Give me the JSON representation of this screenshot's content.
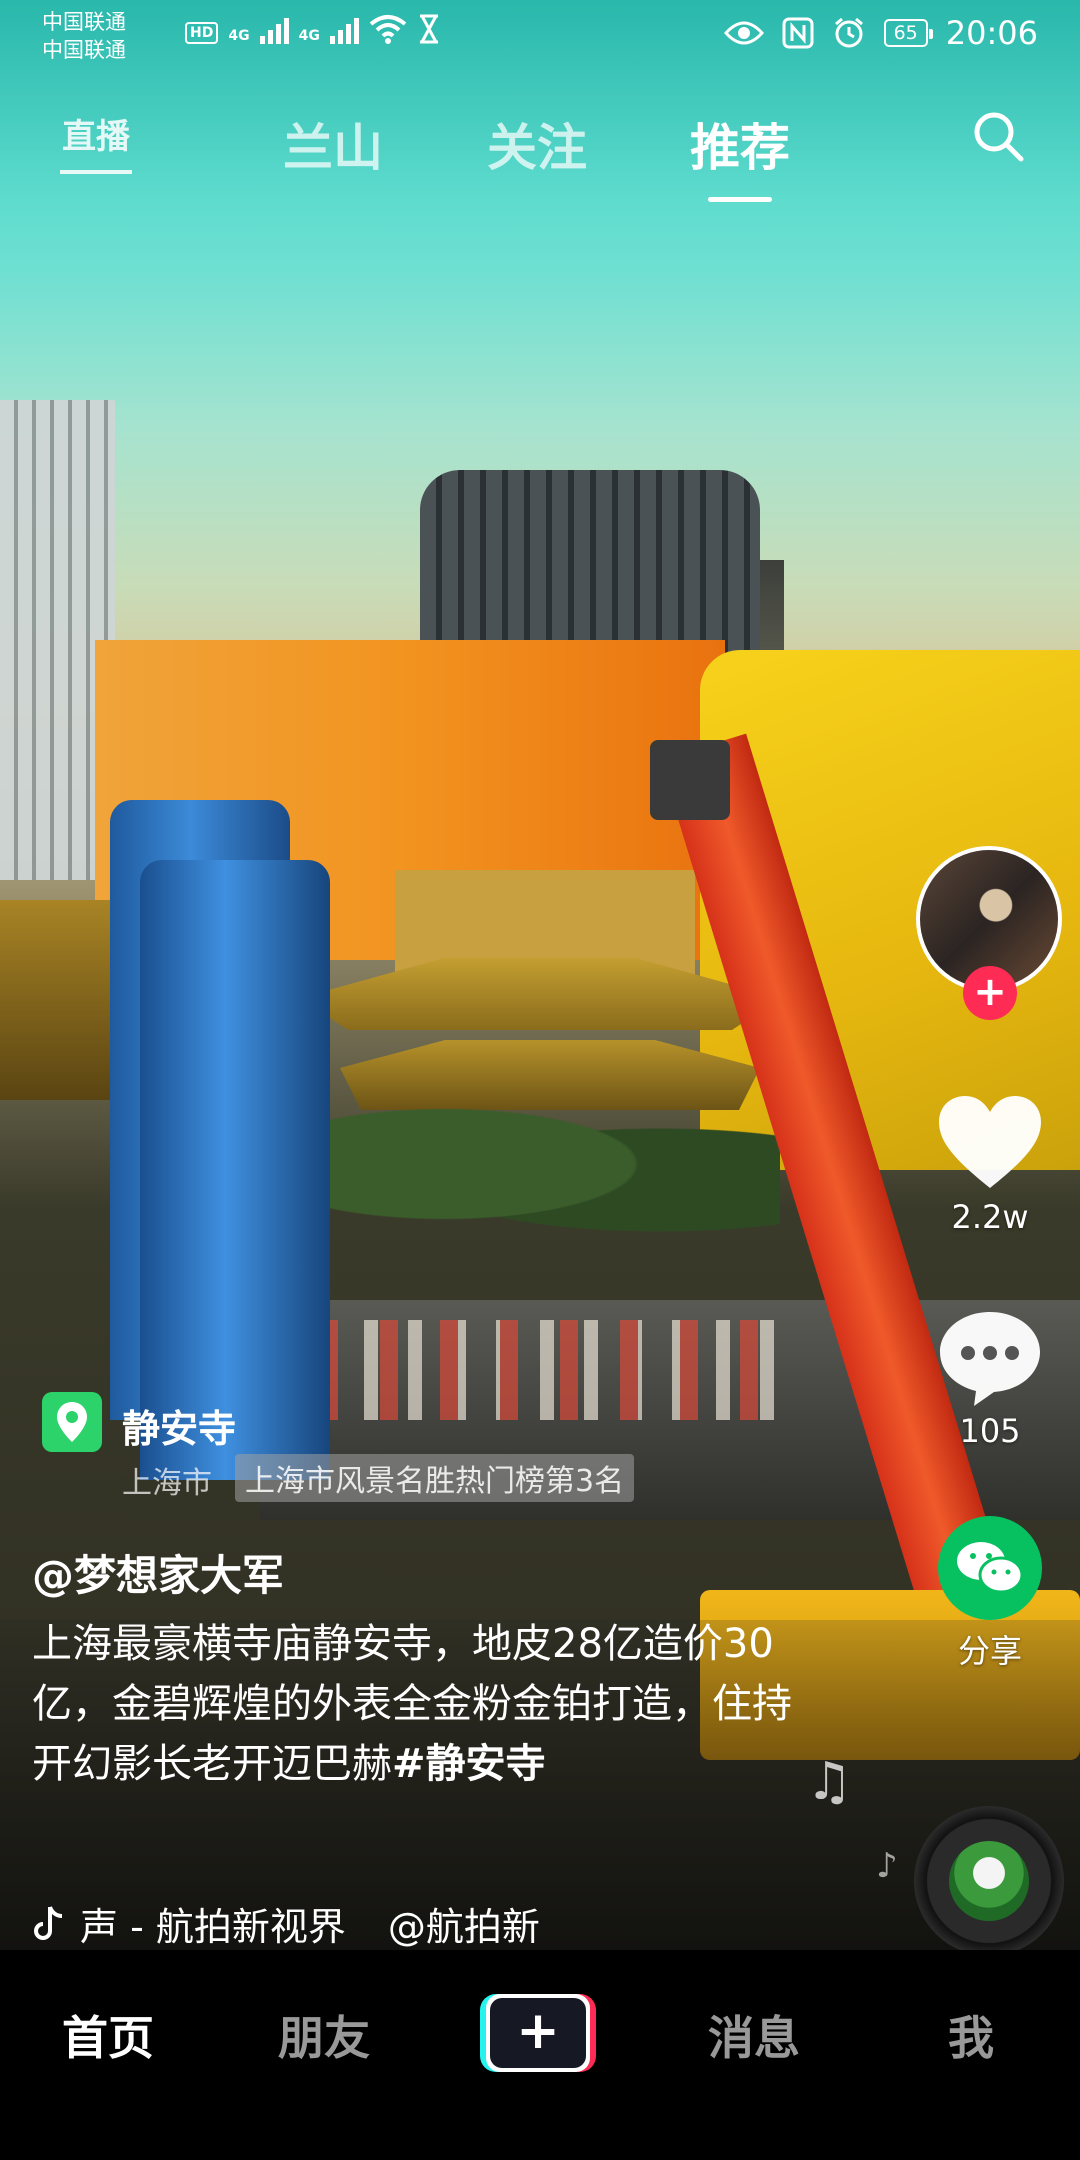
{
  "status_bar": {
    "carrier_1": "中国联通",
    "carrier_2": "中国联通",
    "hd_badge": "HD",
    "network_1": "4G",
    "network_2": "4G",
    "battery": "65",
    "time": "20:06"
  },
  "top_nav": {
    "live_label": "直播",
    "tabs": [
      "兰山",
      "关注",
      "推荐"
    ],
    "active_tab": "推荐"
  },
  "actions": {
    "like_count": "2.2w",
    "comment_count": "105",
    "share_label": "分享"
  },
  "poi": {
    "name": "静安寺",
    "city": "上海市",
    "rank": "上海市风景名胜热门榜第3名"
  },
  "post": {
    "author": "@梦想家大军",
    "description": "上海最豪横寺庙静安寺，地皮28亿造价30亿，金碧辉煌的外表全金粉金铂打造，住持开幻影长老开迈巴赫",
    "hashtag": "#静安寺"
  },
  "music": {
    "label": "声 - 航拍新视界",
    "mention": "@航拍新"
  },
  "bottom_nav": {
    "home": "首页",
    "friends": "朋友",
    "create": "+",
    "messages": "消息",
    "me": "我"
  },
  "colors": {
    "accent_red": "#fe2c55",
    "accent_cyan": "#25f4ee",
    "wechat_green": "#07c160",
    "poi_green": "#2bd36a"
  }
}
